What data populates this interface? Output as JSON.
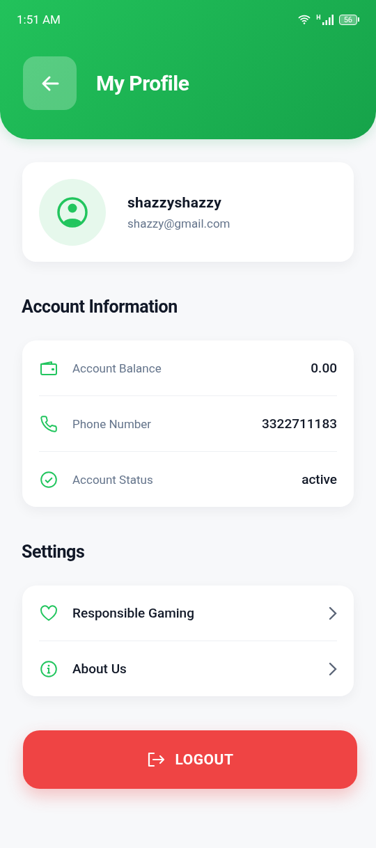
{
  "status_bar": {
    "time": "1:51 AM",
    "network": "H",
    "battery": "56"
  },
  "header": {
    "title": "My Profile"
  },
  "profile": {
    "username": "shazzyshazzy",
    "email": "shazzy@gmail.com"
  },
  "account_information": {
    "title": "Account Information",
    "rows": [
      {
        "label": "Account Balance",
        "value": "0.00"
      },
      {
        "label": "Phone Number",
        "value": "3322711183"
      },
      {
        "label": "Account Status",
        "value": "active"
      }
    ]
  },
  "settings": {
    "title": "Settings",
    "items": [
      {
        "label": "Responsible Gaming"
      },
      {
        "label": "About Us"
      }
    ]
  },
  "logout_button": {
    "label": "LOGOUT"
  }
}
